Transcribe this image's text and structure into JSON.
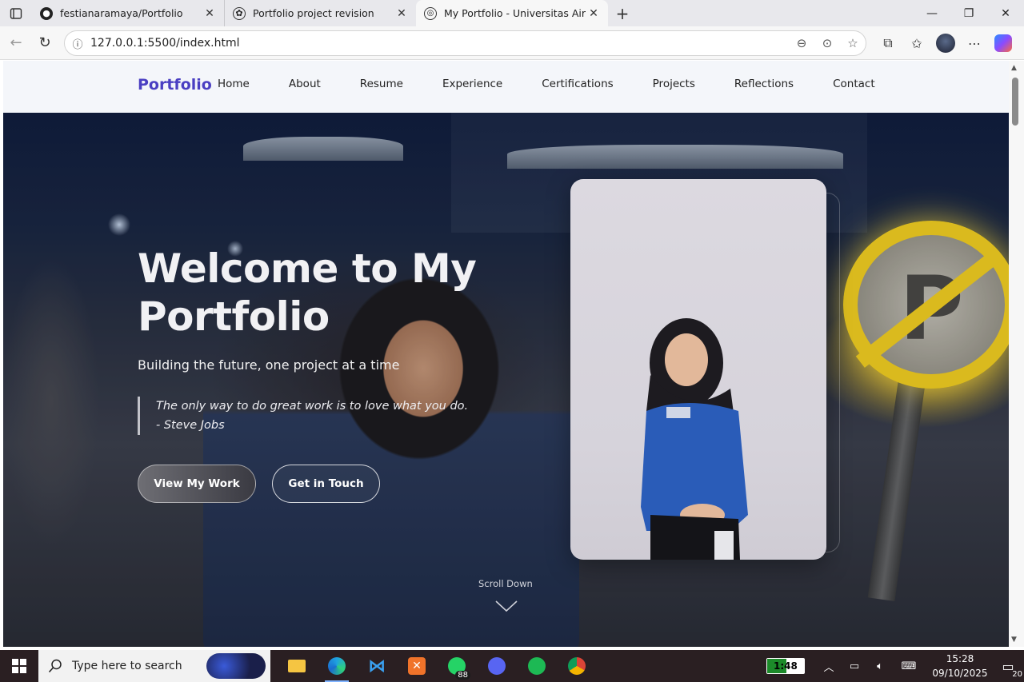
{
  "browser": {
    "tabs": [
      {
        "title": "festianaramaya/Portfolio",
        "icon": "github-icon"
      },
      {
        "title": "Portfolio project revision",
        "icon": "chatgpt-icon"
      },
      {
        "title": "My Portfolio - Universitas Airlangga",
        "icon": "globe-icon",
        "active": true
      }
    ],
    "new_tab": "+",
    "url": "127.0.0.1:5500/index.html"
  },
  "page": {
    "brand": "Portfolio",
    "nav": [
      "Home",
      "About",
      "Resume",
      "Experience",
      "Certifications",
      "Projects",
      "Reflections",
      "Contact"
    ],
    "hero": {
      "title": "Welcome to My Portfolio",
      "subtitle": "Building the future, one project at a time",
      "quote": "The only way to do great work is to love what you do. - Steve Jobs",
      "primary_button": "View My Work",
      "secondary_button": "Get in Touch",
      "scroll_label": "Scroll Down"
    }
  },
  "taskbar": {
    "search_placeholder": "Type here to search",
    "whatsapp_badge": "88",
    "battery_label": "1:48",
    "time": "15:28",
    "date": "09/10/2025",
    "notifications": "20"
  },
  "colors": {
    "brand": "#4a3fc2",
    "taskbar": "#2a1f22"
  }
}
